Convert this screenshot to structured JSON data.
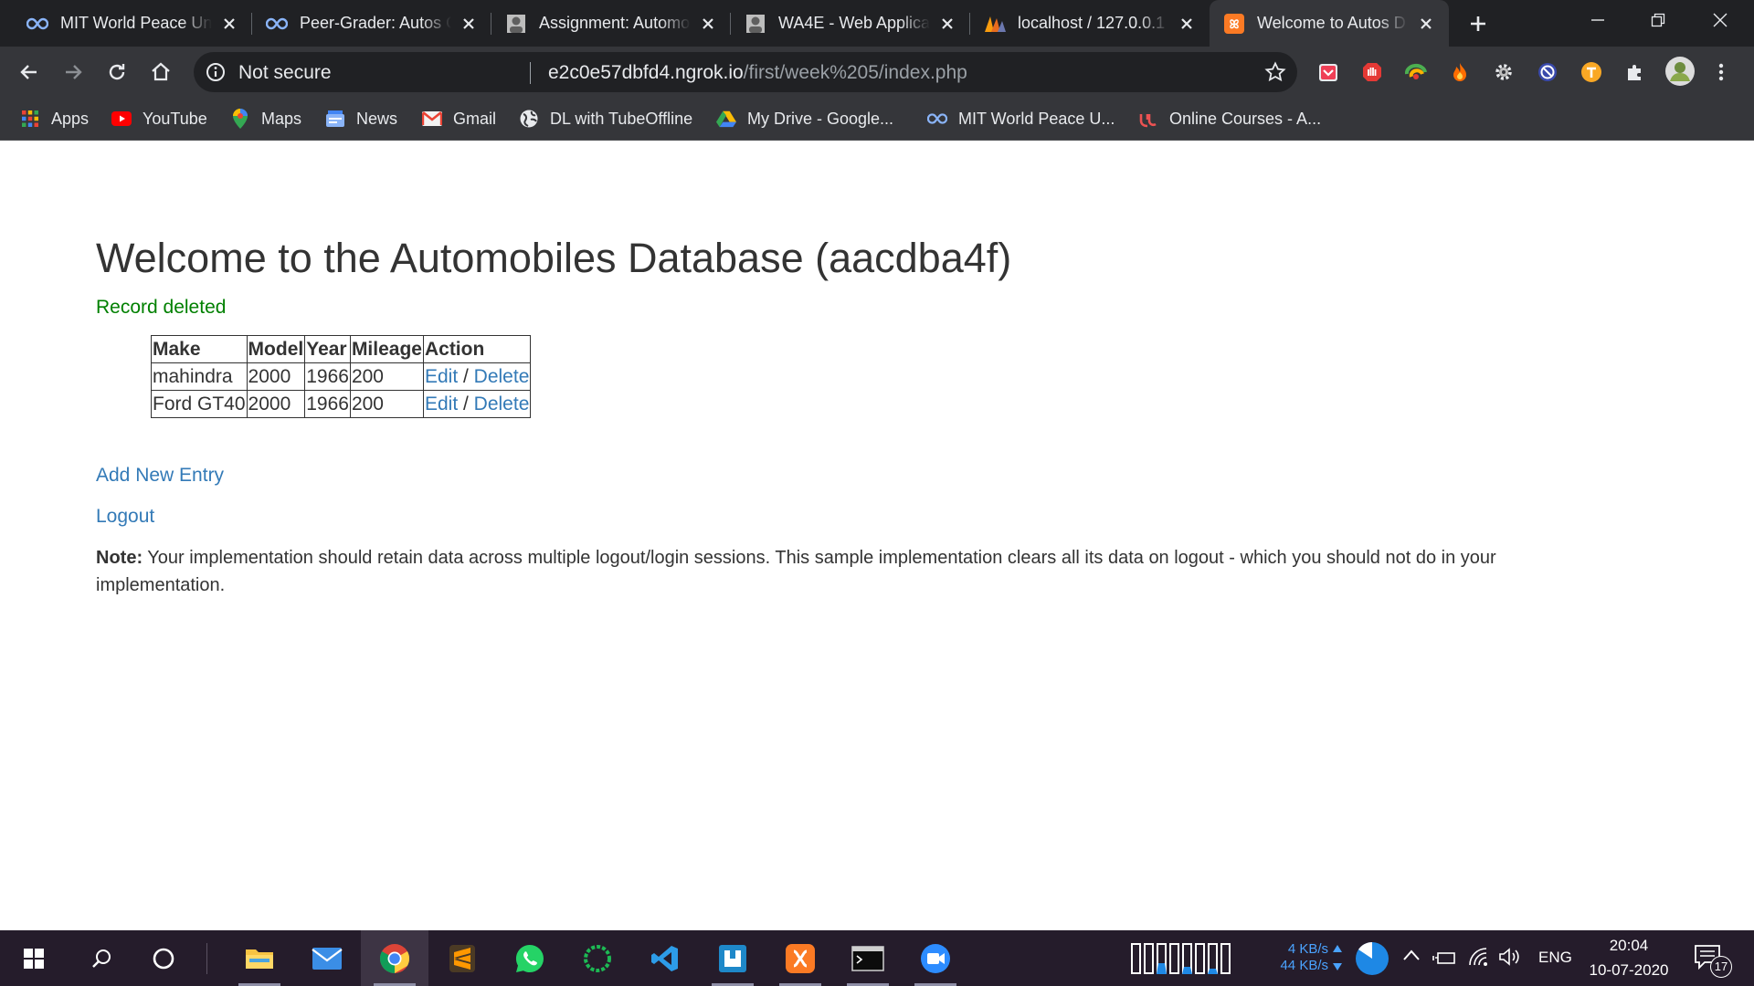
{
  "browser": {
    "tabs": [
      {
        "title": "MIT World Peace Uni",
        "icon": "infinity-icon"
      },
      {
        "title": "Peer-Grader: Autos C",
        "icon": "infinity-icon"
      },
      {
        "title": "Assignment: Automo",
        "icon": "avatar-icon"
      },
      {
        "title": "WA4E - Web Applica",
        "icon": "avatar-icon"
      },
      {
        "title": "localhost / 127.0.0.1",
        "icon": "phpmyadmin-icon"
      },
      {
        "title": "Welcome to Autos D",
        "icon": "xampp-icon",
        "active": true
      }
    ],
    "address": {
      "security": "Not secure",
      "host": "e2c0e57dbfd4.ngrok.io",
      "path": "/first/week%205/index.php"
    },
    "bookmarks": [
      {
        "label": "Apps",
        "icon": "apps-grid-icon"
      },
      {
        "label": "YouTube",
        "icon": "youtube-icon"
      },
      {
        "label": "Maps",
        "icon": "maps-pin-icon"
      },
      {
        "label": "News",
        "icon": "news-icon"
      },
      {
        "label": "Gmail",
        "icon": "gmail-icon"
      },
      {
        "label": "DL with TubeOffline",
        "icon": "globe-icon"
      },
      {
        "label": "My Drive - Google...",
        "icon": "drive-icon"
      },
      {
        "label": "MIT World Peace U...",
        "icon": "infinity-icon"
      },
      {
        "label": "Online Courses - A...",
        "icon": "udemy-icon"
      }
    ]
  },
  "page": {
    "heading": "Welcome to the Automobiles Database (aacdba4f)",
    "flash": "Record deleted",
    "table": {
      "headers": [
        "Make",
        "Model",
        "Year",
        "Mileage",
        "Action"
      ],
      "rows": [
        {
          "make": "mahindra",
          "model": "2000",
          "year": "1966",
          "mileage": "200"
        },
        {
          "make": "Ford GT40",
          "model": "2000",
          "year": "1966",
          "mileage": "200"
        }
      ],
      "edit_label": "Edit",
      "separator": " / ",
      "delete_label": "Delete"
    },
    "add_link": "Add New Entry",
    "logout_link": "Logout",
    "note_label": "Note:",
    "note_text": " Your implementation should retain data across multiple logout/login sessions. This sample implementation clears all its data on logout - which you should not do in your implementation."
  },
  "taskbar": {
    "net_up": "4 KB/s",
    "net_down": "44 KB/s",
    "language": "ENG",
    "time": "20:04",
    "date": "10-07-2020",
    "notifications": "17"
  },
  "colors": {
    "link": "#337ab7",
    "flash": "#008000",
    "tab_strip": "#202124",
    "toolbar": "#35363a",
    "taskbar": "#251c2b"
  }
}
